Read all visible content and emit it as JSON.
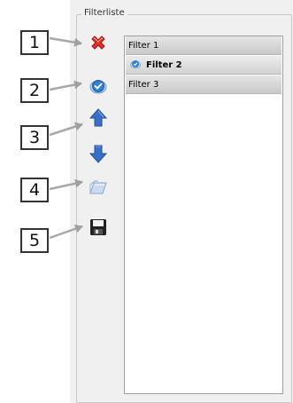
{
  "group": {
    "title": "Filterliste"
  },
  "filters": [
    {
      "label": "Filter 1",
      "selected": false,
      "has_icon": false
    },
    {
      "label": "Filter 2",
      "selected": true,
      "has_icon": true
    },
    {
      "label": "Filter 3",
      "selected": false,
      "has_icon": false
    }
  ],
  "toolbar": [
    {
      "icon": "delete-icon",
      "accent": "#e0302a"
    },
    {
      "icon": "apply-icon",
      "accent": "#2f7fd2"
    },
    {
      "icon": "move-up-icon",
      "accent": "#3a6fc9"
    },
    {
      "icon": "move-down-icon",
      "accent": "#3a6fc9"
    },
    {
      "icon": "open-folder-icon",
      "accent": "#9bb8dd"
    },
    {
      "icon": "save-icon",
      "accent": "#222222"
    }
  ],
  "callouts": [
    "1",
    "2",
    "3",
    "4",
    "5"
  ]
}
